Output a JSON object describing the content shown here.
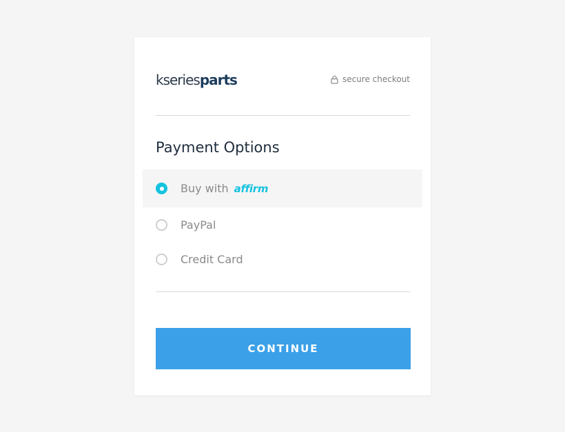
{
  "brand": {
    "logo_part1": "kseries",
    "logo_part2": "parts"
  },
  "header": {
    "secure_label": "secure checkout"
  },
  "payment": {
    "title": "Payment Options",
    "options": [
      {
        "label": "Buy with",
        "brand": "affirm",
        "selected": true
      },
      {
        "label": "PayPal",
        "selected": false
      },
      {
        "label": "Credit Card",
        "selected": false
      }
    ]
  },
  "actions": {
    "continue_label": "CONTINUE"
  },
  "colors": {
    "accent": "#15c3e0",
    "button": "#3ba0e8",
    "background": "#f5f5f5"
  }
}
